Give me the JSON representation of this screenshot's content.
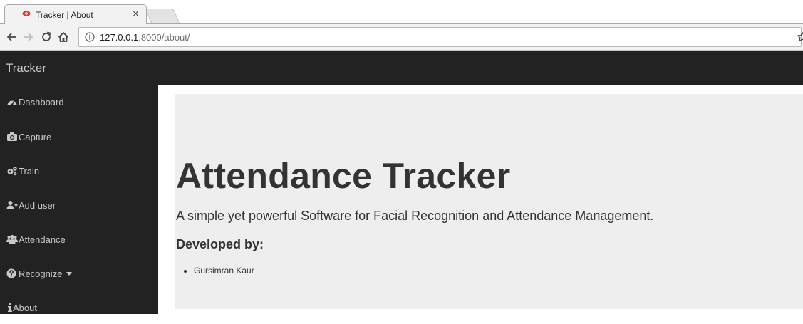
{
  "browser": {
    "tab_title": "Tracker | About",
    "tab_close": "×",
    "url_host": "127.0.0.1",
    "url_rest": ":8000/about/"
  },
  "app": {
    "brand": "Tracker",
    "sidebar": [
      {
        "label": "Dashboard",
        "icon": "tachometer-icon"
      },
      {
        "label": "Capture",
        "icon": "camera-icon"
      },
      {
        "label": "Train",
        "icon": "gears-icon"
      },
      {
        "label": "Add user",
        "icon": "user-plus-icon"
      },
      {
        "label": "Attendance",
        "icon": "users-icon"
      },
      {
        "label": "Recognize",
        "icon": "question-circle-icon",
        "dropdown": true
      },
      {
        "label": "About",
        "icon": "info-icon"
      }
    ]
  },
  "content": {
    "title": "Attendance Tracker",
    "lead": "A simple yet powerful Software for Facial Recognition and Attendance Management.",
    "developed_by": "Developed by:",
    "developers": [
      "Gursimran Kaur"
    ]
  },
  "colors": {
    "navbar_bg": "#222222",
    "nav_text": "#c8c8c8",
    "jumbotron_bg": "#eeeeee",
    "favicon": "#e53935"
  }
}
